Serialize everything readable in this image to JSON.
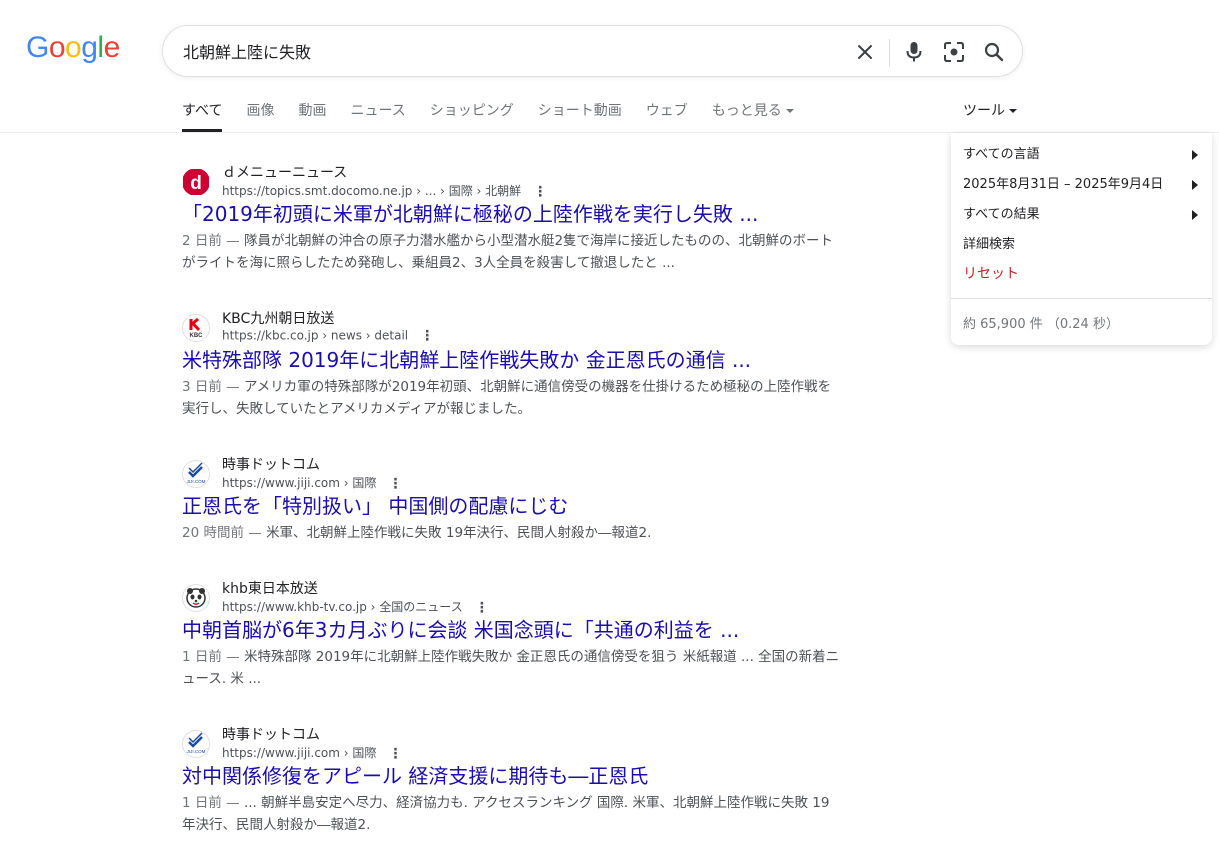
{
  "logo": {
    "letters": [
      "G",
      "o",
      "o",
      "g",
      "l",
      "e"
    ],
    "colors": [
      "#4285f4",
      "#ea4335",
      "#fbbc05",
      "#4285f4",
      "#34a853",
      "#ea4335"
    ]
  },
  "search": {
    "query": "北朝鮮上陸に失敗",
    "icons": [
      "close-icon",
      "mic-icon",
      "lens-icon",
      "search-icon"
    ]
  },
  "tabs": [
    "すべて",
    "画像",
    "動画",
    "ニュース",
    "ショッピング",
    "ショート動画",
    "ウェブ",
    "もっと見る"
  ],
  "tools": {
    "label": "ツール",
    "items": [
      "すべての言語",
      "2025年8月31日 – 2025年9月4日",
      "すべての結果",
      "詳細検索"
    ],
    "reset": "リセット",
    "stats": "約 65,900 件 （0.24 秒）"
  },
  "results": [
    {
      "site": "ｄメニューニュース",
      "url": "https://topics.smt.docomo.ne.jp",
      "crumbs": " › ... › 国際 › 北朝鮮",
      "title": "「2019年初頭に米軍が北朝鮮に極秘の上陸作戦を実行し失敗 ...",
      "age": "2 日前 — ",
      "snippet": "隊員が北朝鮮の沖合の原子力潜水艦から小型潜水艇2隻で海岸に接近したものの、北朝鮮のボートがライトを海に照らしたため発砲し、乗組員2、3人全員を殺害して撤退したと ..."
    },
    {
      "site": "KBC九州朝日放送",
      "url": "https://kbc.co.jp",
      "crumbs": " › news › detail",
      "title": "米特殊部隊 2019年に北朝鮮上陸作戦失敗か 金正恩氏の通信 ...",
      "age": "3 日前 — ",
      "snippet": "アメリカ軍の特殊部隊が2019年初頭、北朝鮮に通信傍受の機器を仕掛けるため極秘の上陸作戦を実行し、失敗していたとアメリカメディアが報じました。"
    },
    {
      "site": "時事ドットコム",
      "url": "https://www.jiji.com",
      "crumbs": " › 国際",
      "title": "正恩氏を「特別扱い」 中国側の配慮にじむ",
      "age": "20 時間前 — ",
      "snippet": "米軍、北朝鮮上陸作戦に失敗 19年決行、民間人射殺か―報道2."
    },
    {
      "site": "khb東日本放送",
      "url": "https://www.khb-tv.co.jp",
      "crumbs": " › 全国のニュース",
      "title": "中朝首脳が6年3カ月ぶりに会談 米国念頭に「共通の利益を ...",
      "age": "1 日前 — ",
      "snippet": "米特殊部隊 2019年に北朝鮮上陸作戦失敗か 金正恩氏の通信傍受を狙う 米紙報道 ... 全国の新着ニュース. 米 ..."
    },
    {
      "site": "時事ドットコム",
      "url": "https://www.jiji.com",
      "crumbs": " › 国際",
      "title": "対中関係修復をアピール 経済支援に期待も―正恩氏",
      "age": "1 日前 — ",
      "snippet": "... 朝鮮半島安定へ尽力、経済協力も. アクセスランキング 国際. 米軍、北朝鮮上陸作戦に失敗 19年決行、民間人射殺か―報道2."
    }
  ]
}
